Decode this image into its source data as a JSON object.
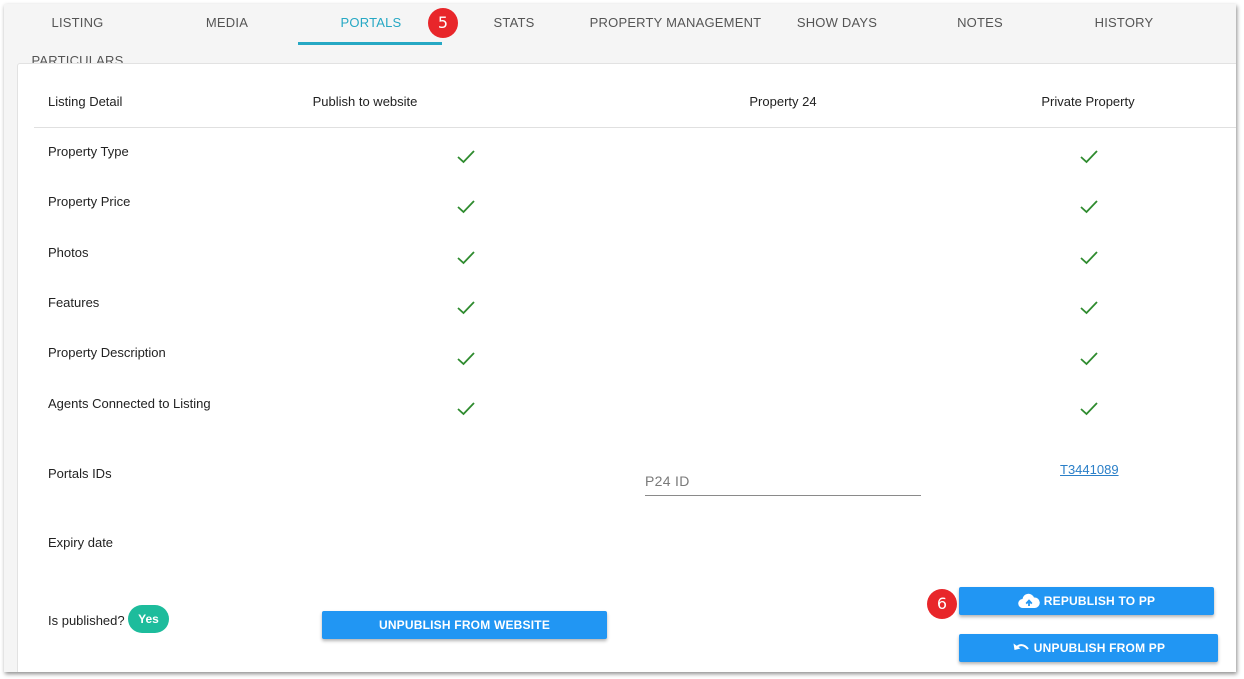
{
  "tabs": [
    {
      "label": "LISTING PARTICULARS",
      "active": false
    },
    {
      "label": "MEDIA",
      "active": false
    },
    {
      "label": "PORTALS",
      "active": true
    },
    {
      "label": "STATS",
      "active": false
    },
    {
      "label": "PROPERTY MANAGEMENT",
      "active": false
    },
    {
      "label": "SHOW DAYS",
      "active": false
    },
    {
      "label": "NOTES",
      "active": false
    },
    {
      "label": "HISTORY",
      "active": false
    }
  ],
  "badges": {
    "first": "5",
    "second": "6"
  },
  "table": {
    "headers": [
      "Listing Detail",
      "Publish to website",
      "Property 24",
      "Private Property"
    ],
    "rows": [
      {
        "label": "Property Type",
        "website": true,
        "p24": false,
        "pp": true
      },
      {
        "label": "Property Price",
        "website": true,
        "p24": false,
        "pp": true
      },
      {
        "label": "Photos",
        "website": true,
        "p24": false,
        "pp": true
      },
      {
        "label": "Features",
        "website": true,
        "p24": false,
        "pp": true
      },
      {
        "label": "Property Description",
        "website": true,
        "p24": false,
        "pp": true
      },
      {
        "label": "Agents Connected to Listing",
        "website": true,
        "p24": false,
        "pp": true
      }
    ],
    "portals_ids_label": "Portals IDs",
    "p24_placeholder": "P24 ID",
    "pp_id": "T3441089",
    "expiry_label": "Expiry date",
    "is_published_label": "Is published?",
    "is_published_value": "Yes"
  },
  "buttons": {
    "unpublish_website": "UNPUBLISH FROM WEBSITE",
    "republish_pp": "REPUBLISH TO PP",
    "unpublish_pp": "UNPUBLISH FROM PP"
  },
  "colors": {
    "accent": "#26a8c4",
    "check": "#2e8b2e",
    "button": "#2196f3",
    "badge": "#e8262a",
    "pill": "#1dbc9c"
  }
}
